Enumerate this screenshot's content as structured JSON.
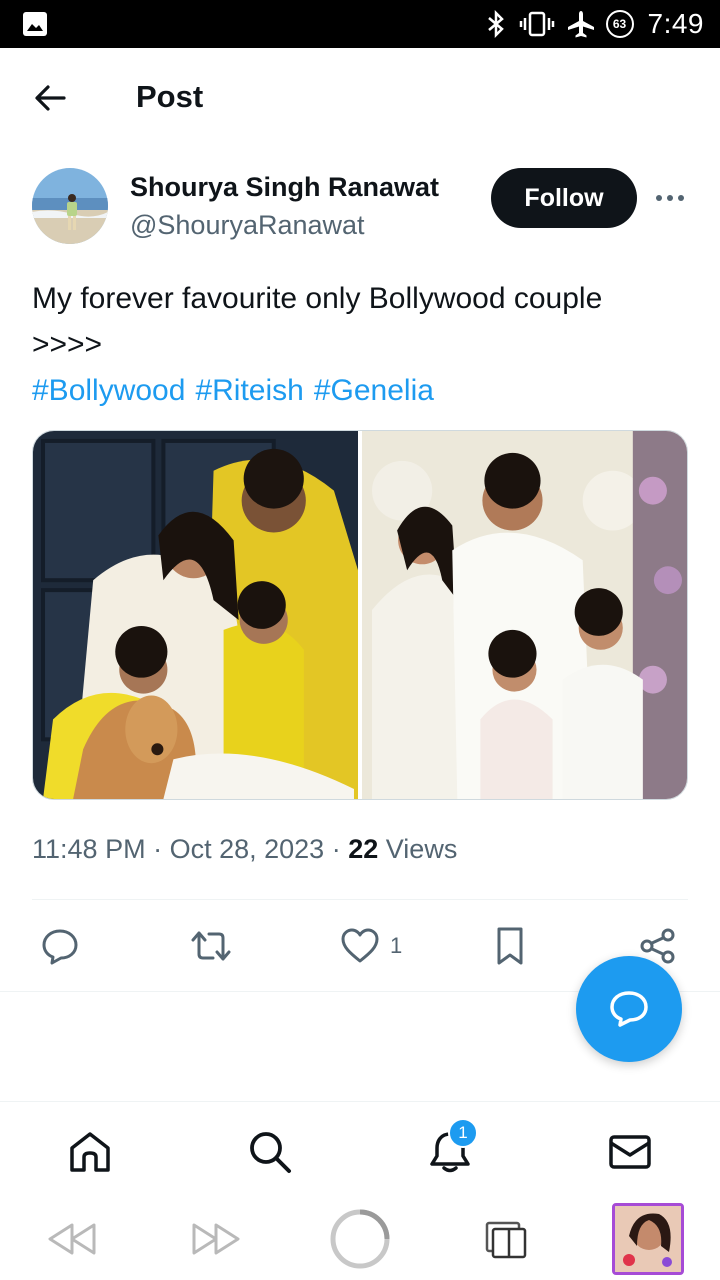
{
  "status_bar": {
    "time": "7:49",
    "battery": "63",
    "icons": [
      "image-icon",
      "bluetooth-icon",
      "vibrate-icon",
      "airplane-icon",
      "battery-icon"
    ]
  },
  "header": {
    "title": "Post"
  },
  "post": {
    "author_name": "Shourya Singh Ranawat",
    "author_handle": "@ShouryaRanawat",
    "follow_label": "Follow",
    "text_line1": "My forever favourite only Bollywood couple",
    "text_line2": ">>>>",
    "hashtags": [
      "#Bollywood",
      "#Riteish",
      "#Genelia"
    ],
    "time": "11:48 PM",
    "date": "Oct 28, 2023",
    "views_count": "22",
    "views_label": "Views",
    "like_count": "1"
  },
  "bottom_nav": {
    "notification_badge": "1"
  },
  "colors": {
    "accent": "#1d9bf0",
    "text": "#0f1419",
    "muted": "#536471",
    "follow_bg": "#0f1419"
  }
}
